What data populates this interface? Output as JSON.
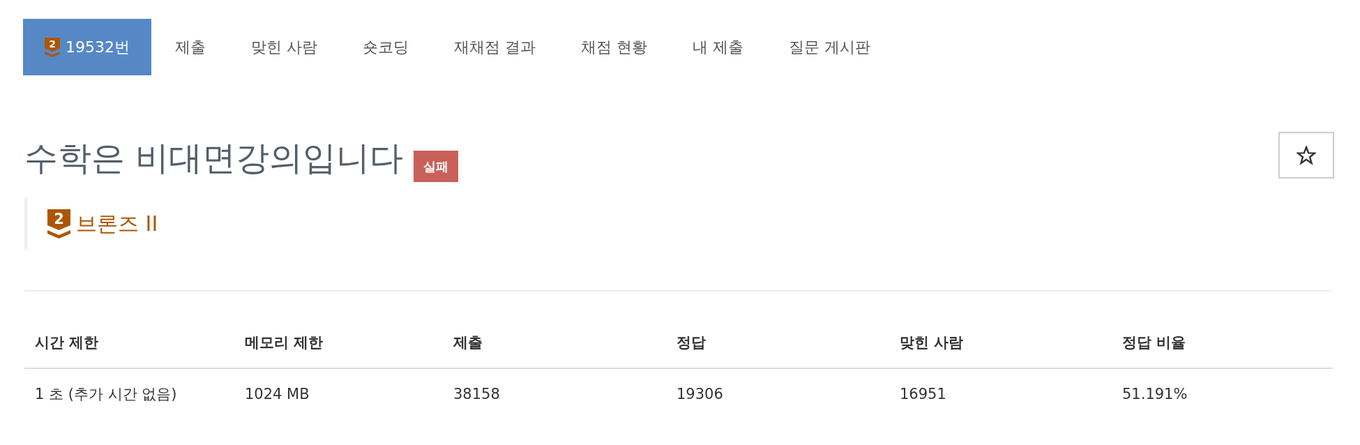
{
  "nav": {
    "tabs": [
      {
        "label": "19532번",
        "badge": "2",
        "selected": true
      },
      {
        "label": "제출",
        "selected": false
      },
      {
        "label": "맞힌 사람",
        "selected": false
      },
      {
        "label": "숏코딩",
        "selected": false
      },
      {
        "label": "재채점 결과",
        "selected": false
      },
      {
        "label": "채점 현황",
        "selected": false
      },
      {
        "label": "내 제출",
        "selected": false
      },
      {
        "label": "질문 게시판",
        "selected": false
      }
    ]
  },
  "problem": {
    "title": "수학은 비대면강의입니다",
    "result": {
      "label": "실패",
      "kind": "fail"
    },
    "favorite": {
      "on": false
    }
  },
  "tier": {
    "badge": "2",
    "name": "브론즈 II"
  },
  "table": {
    "columns": [
      "시간 제한",
      "메모리 제한",
      "제출",
      "정답",
      "맞힌 사람",
      "정답 비율"
    ],
    "rows": [
      [
        "1 초 (추가 시간 없음)",
        "1024 MB",
        "38158",
        "19306",
        "16951",
        "51.191%"
      ]
    ]
  }
}
